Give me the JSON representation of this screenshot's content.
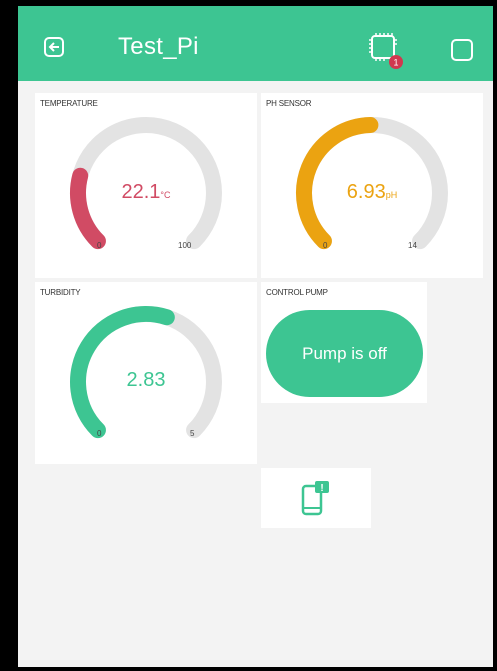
{
  "header": {
    "title": "Test_Pi",
    "device_badge": "1",
    "bg_color": "#3dc592"
  },
  "widgets": {
    "temperature": {
      "label": "TEMPERATURE",
      "value": "22.1",
      "unit": "°C",
      "min": "0",
      "max": "100",
      "value_num": 22.1,
      "min_num": 0,
      "max_num": 100,
      "color": "#d14b64"
    },
    "ph": {
      "label": "PH SENSOR",
      "value": "6.93",
      "unit": "pH",
      "min": "0",
      "max": "14",
      "value_num": 6.93,
      "min_num": 0,
      "max_num": 14,
      "color": "#eba311"
    },
    "turbidity": {
      "label": "TURBIDITY",
      "value": "2.83",
      "unit": "",
      "min": "0",
      "max": "5",
      "value_num": 2.83,
      "min_num": 0,
      "max_num": 5,
      "color": "#3dc592"
    },
    "pump": {
      "label": "CONTROL PUMP",
      "button_label": "Pump is off",
      "color": "#3dc592"
    },
    "notification": {
      "badge": "!",
      "icon": "phone-notification-icon"
    }
  }
}
